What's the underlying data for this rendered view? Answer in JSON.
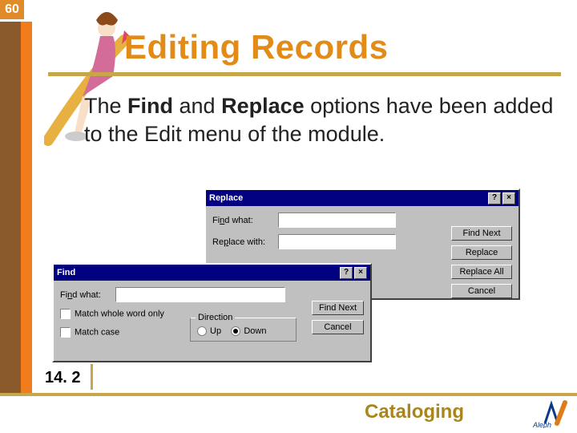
{
  "page_number": "60",
  "title": "Editing Records",
  "body": {
    "pre": "The ",
    "b1": "Find",
    "mid": " and ",
    "b2": "Replace",
    "post": " options have been added to the Edit menu of the module."
  },
  "replace_dlg": {
    "title": "Replace",
    "help": "?",
    "close": "×",
    "find_what_u": "n",
    "find_what_rest": "d what:",
    "find_what_pre": "Fi",
    "replace_with_pre": "Re",
    "replace_with_u": "p",
    "replace_with_rest": "lace with:",
    "btn_find_next_u": "F",
    "btn_find_next_rest": "ind Next",
    "btn_replace_u": "R",
    "btn_replace_rest": "eplace",
    "btn_replace_all_pre": "Replace ",
    "btn_replace_all_u": "A",
    "btn_replace_all_rest": "ll",
    "btn_cancel": "Cancel"
  },
  "find_dlg": {
    "title": "Find",
    "help": "?",
    "close": "×",
    "find_what_pre": "Fi",
    "find_what_u": "n",
    "find_what_rest": "d what:",
    "whole_word_pre": "Match ",
    "whole_word_u": "w",
    "whole_word_rest": "hole word only",
    "match_case_pre": "Match ",
    "match_case_u": "c",
    "match_case_rest": "ase",
    "direction": "Direction",
    "up_u": "U",
    "up_rest": "p",
    "down_u": "D",
    "down_rest": "own",
    "btn_find_next_u": "F",
    "btn_find_next_rest": "ind Next",
    "btn_cancel": "Cancel"
  },
  "section_number": "14. 2",
  "footer_label": "Cataloging",
  "logo_text": "Aleph"
}
